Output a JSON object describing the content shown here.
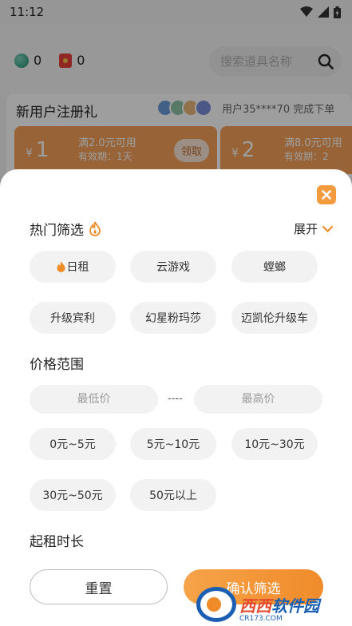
{
  "status_bar": {
    "time": "11:12"
  },
  "wallet": {
    "coins": "0",
    "redpacks": "0"
  },
  "search": {
    "placeholder": "搜索道具名称"
  },
  "gift_banner": {
    "title": "新用户注册礼",
    "activity": "用户35****70 完成下单",
    "coupons": [
      {
        "currency": "¥",
        "amount": "1",
        "condition": "满2.0元可用",
        "validity": "有效期：1天",
        "action": "领取"
      },
      {
        "currency": "¥",
        "amount": "2",
        "condition": "满8.0元可用",
        "validity": "有效期：2"
      }
    ]
  },
  "filter_sheet": {
    "hot_filter": {
      "title": "热门筛选",
      "expand_label": "展开",
      "chips": [
        "日租",
        "云游戏",
        "螳螂",
        "升级宾利",
        "幻星粉玛莎",
        "迈凯伦升级车"
      ]
    },
    "price_range": {
      "title": "价格范围",
      "min_placeholder": "最低价",
      "max_placeholder": "最高价",
      "separator": "----",
      "options": [
        "0元~5元",
        "5元~10元",
        "10元~30元",
        "30元~50元",
        "50元以上"
      ]
    },
    "rental_duration": {
      "title": "起租时长"
    },
    "reset_label": "重置",
    "confirm_label": "确认筛选"
  },
  "watermark": {
    "brand_a": "西西",
    "brand_b": "软件园",
    "site": "CR173.COM"
  },
  "colors": {
    "accent": "#f49a3f",
    "chip_bg": "#f2f2f2",
    "coupon": "#f5a25a",
    "watermark_blue": "#1b5fb3"
  }
}
